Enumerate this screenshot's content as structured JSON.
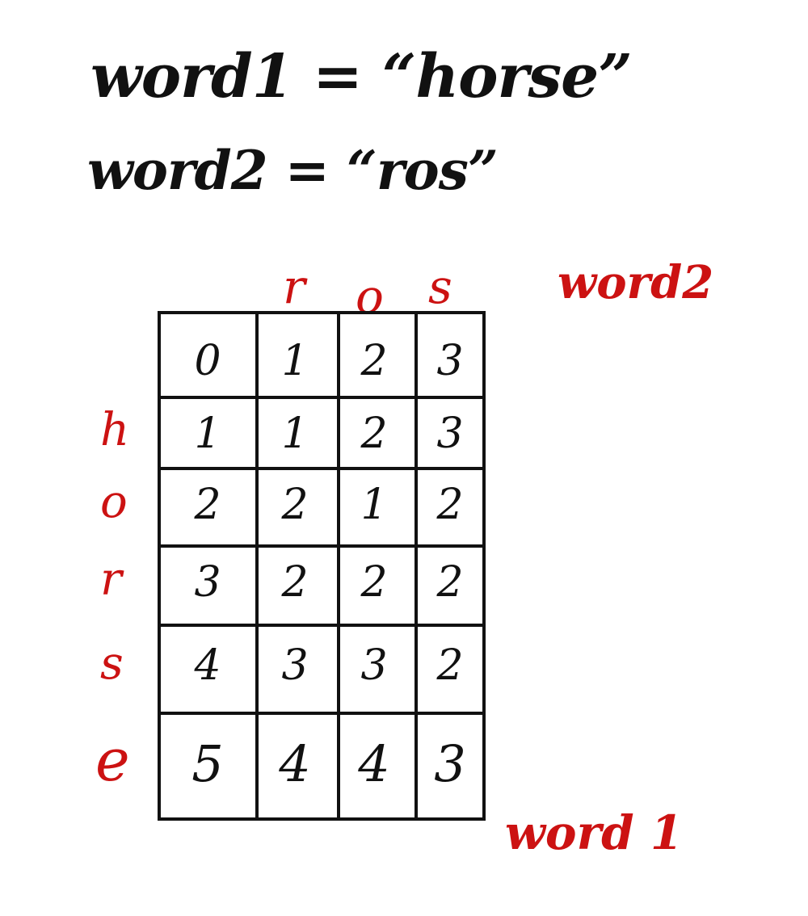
{
  "equations": {
    "word1": "word1 = “horse”",
    "word2": "word2 = “ros”"
  },
  "labels": {
    "word2": "word2",
    "word1": "word 1"
  },
  "col_headers": [
    "r",
    "o",
    "s"
  ],
  "row_headers": [
    "h",
    "o",
    "r",
    "s",
    "e"
  ],
  "table": [
    [
      "0",
      "1",
      "2",
      "3"
    ],
    [
      "1",
      "1",
      "2",
      "3"
    ],
    [
      "2",
      "2",
      "1",
      "2"
    ],
    [
      "3",
      "2",
      "2",
      "2"
    ],
    [
      "4",
      "3",
      "3",
      "2"
    ],
    [
      "5",
      "4",
      "4",
      "3"
    ]
  ],
  "colors": {
    "ink": "#111111",
    "annotation": "#cc1212"
  }
}
